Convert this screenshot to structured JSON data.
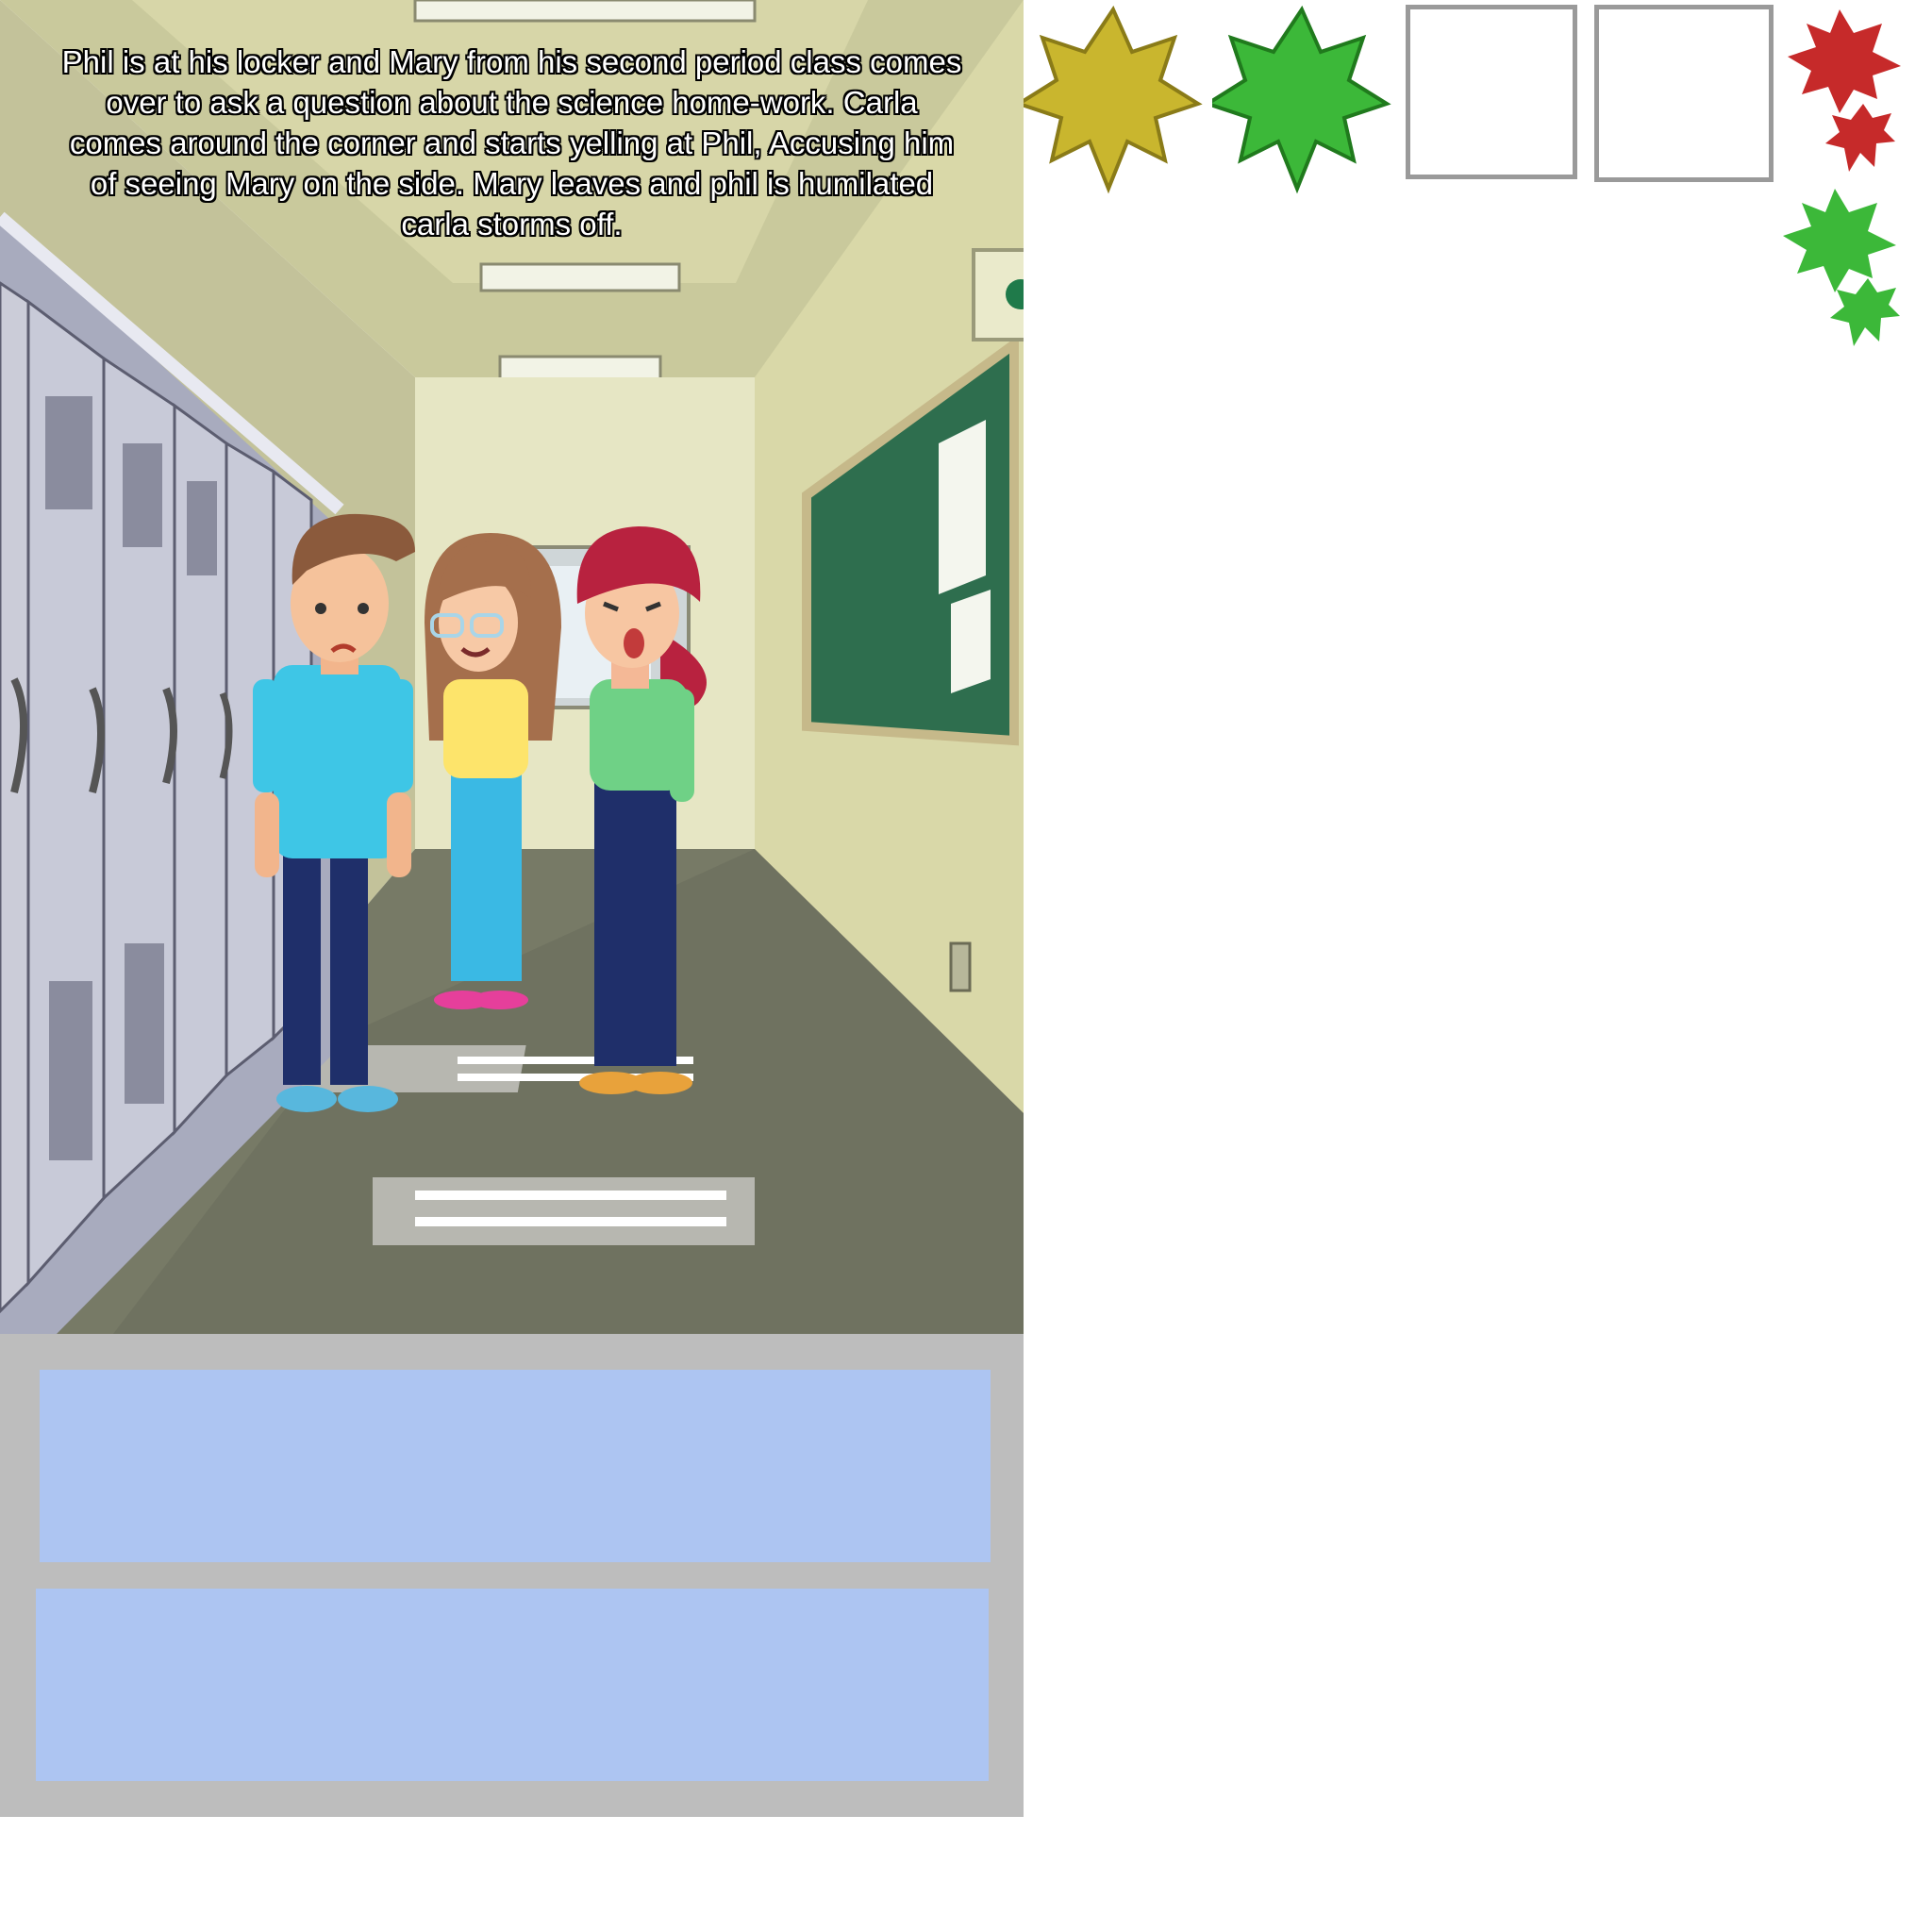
{
  "story": {
    "text": "Phil is at his locker and Mary from his second period class comes over to ask a question about the science home-work. Carla comes around the corner and starts yelling at Phil, Accusing him of seeing Mary on the side. Mary leaves and phil is humilated carla storms off."
  },
  "characters": [
    {
      "name": "Phil",
      "expression": "upset"
    },
    {
      "name": "Mary",
      "expression": "smiling"
    },
    {
      "name": "Carla",
      "expression": "yelling"
    }
  ],
  "dialog": {
    "choices": [
      {
        "text": ""
      },
      {
        "text": ""
      }
    ]
  },
  "inventory": {
    "items": [
      {
        "icon": "gold-leaf-icon",
        "color": "#c9b62e"
      },
      {
        "icon": "green-leaf-icon",
        "color": "#3cb839"
      },
      {
        "icon": "empty-slot-icon"
      },
      {
        "icon": "empty-slot-icon"
      },
      {
        "icon": "red-green-leaves-icon",
        "colors": [
          "#c62a2a",
          "#3cb839"
        ]
      }
    ]
  },
  "colors": {
    "choice_box": "#adc5f2",
    "panel": "#bdbdbd",
    "wall": "#d8d8a6",
    "floor": "#777a66",
    "locker": "#c8cad8",
    "board": "#2e6e4e"
  }
}
